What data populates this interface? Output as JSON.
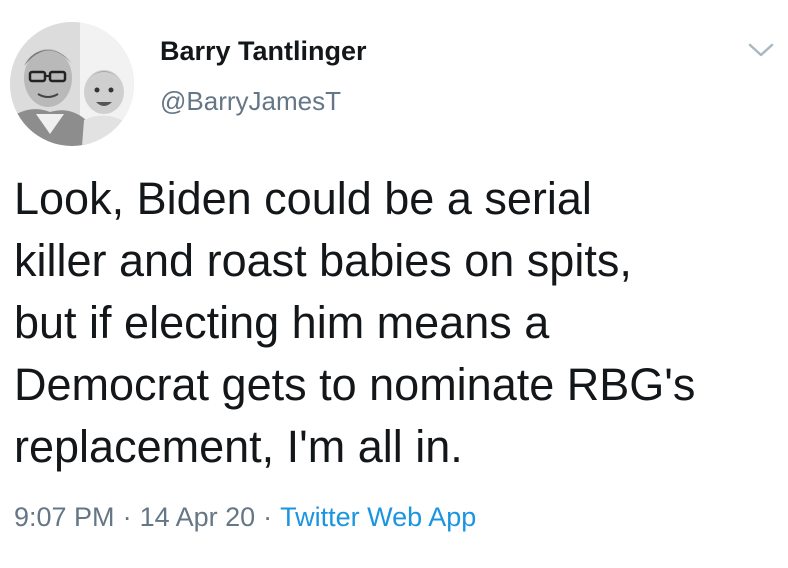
{
  "tweet": {
    "author": {
      "name": "Barry Tantlinger",
      "handle": "@BarryJamesT"
    },
    "text": "Look, Biden could be a serial\nkiller and roast babies on spits,\nbut if electing him means a\nDemocrat gets to nominate RBG's\nreplacement, I'm all in.",
    "time": "9:07 PM",
    "separator": "·",
    "date": "14 Apr 20",
    "source": "Twitter Web App"
  },
  "icons": {
    "menu": "chevron-down-icon",
    "avatar": "profile-photo"
  },
  "colors": {
    "text": "#14171a",
    "secondary": "#657786",
    "link": "#1b95e0"
  }
}
